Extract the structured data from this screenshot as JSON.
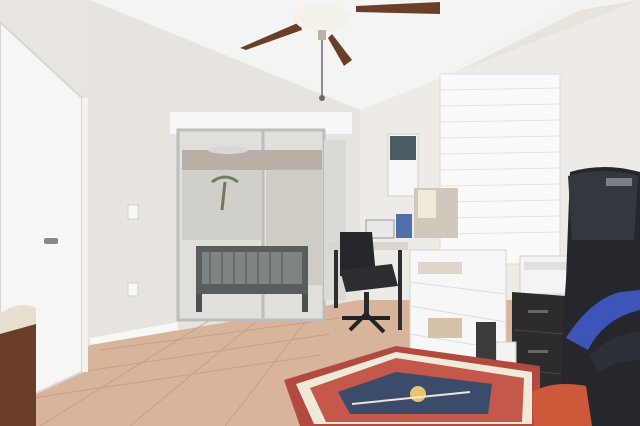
{
  "scene": {
    "alt": "",
    "colors": {
      "ceiling": "#f1f1ef",
      "wall_left": "#e9e6e1",
      "wall_right": "#efede8",
      "floor_tile": "#d9b69b",
      "rug_red": "#b24a3f",
      "rug_blue": "#3b4b6a",
      "fan_blade": "#6a3f2a",
      "chair_black": "#25272c",
      "gaming_chair_blue": "#3b56b8",
      "shelf_white": "#f7f7f7",
      "cabinet_dark": "#2d2b2b",
      "window_blind": "#f8f8f8",
      "glass_exterior": "#d8d7d2",
      "door_white": "#f4f4f4"
    },
    "elements": [
      "ceiling-fan",
      "sliding-glass-door",
      "patio-bench",
      "interior-door",
      "window-blinds",
      "wall-calendar",
      "desk",
      "office-chair",
      "storage-shelf",
      "printer",
      "filing-cabinet",
      "gaming-chair",
      "area-rug",
      "tile-floor",
      "wall-switch",
      "wall-outlet"
    ]
  }
}
